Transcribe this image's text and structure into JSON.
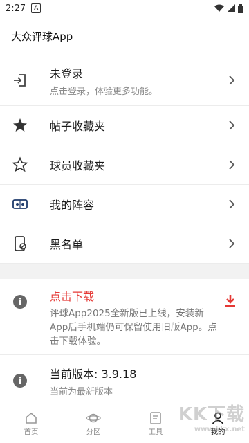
{
  "status": {
    "time": "2:27",
    "badge": "A"
  },
  "app": {
    "title": "大众评球App"
  },
  "login": {
    "title": "未登录",
    "subtitle": "点击登录，体验更多功能。"
  },
  "menu": [
    {
      "label": "帖子收藏夹",
      "icon": "star-filled-icon"
    },
    {
      "label": "球员收藏夹",
      "icon": "star-outline-icon"
    },
    {
      "label": "我的阵容",
      "icon": "lineup-icon"
    },
    {
      "label": "黑名单",
      "icon": "blacklist-phone-icon"
    }
  ],
  "notice": {
    "title": "点击下载",
    "body": "评球App2025全新版已上线，安装新App后手机端仍可保留使用旧版App。点击下载体验。"
  },
  "version": {
    "title": "当前版本: 3.9.18",
    "subtitle": "当前为最新版本"
  },
  "tabs": [
    {
      "label": "首页",
      "icon": "home-icon"
    },
    {
      "label": "分区",
      "icon": "planet-icon"
    },
    {
      "label": "工具",
      "icon": "document-icon"
    },
    {
      "label": "我的",
      "icon": "person-icon"
    }
  ],
  "watermark": {
    "main": "KK下载",
    "sub": "www.kkx.net"
  },
  "colors": {
    "accent_red": "#e53935",
    "text_muted": "#8a8a8a"
  }
}
